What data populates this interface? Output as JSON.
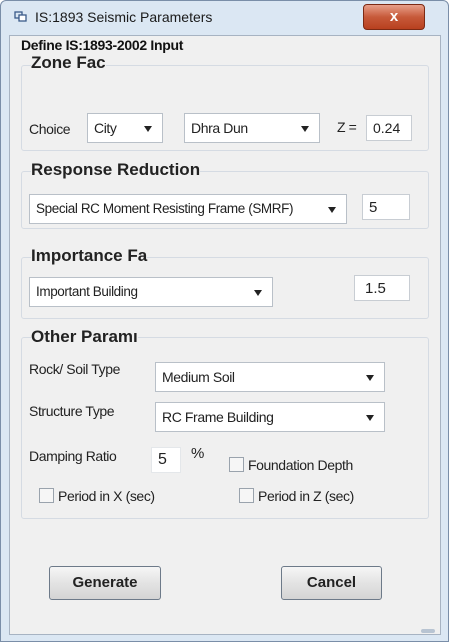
{
  "window": {
    "title": "IS:1893 Seismic Parameters",
    "close_label": "x"
  },
  "define_label": "Define IS:1893-2002 Input",
  "zone": {
    "title": "Zone Fac",
    "choice_label": "Choice",
    "choice_value": "City",
    "city_value": "Dhra Dun",
    "z_label": "Z =",
    "z_value": "0.24"
  },
  "response": {
    "title": "Response Reduction",
    "frame_value": "Special RC Moment Resisting Frame (SMRF)",
    "r_value": "5"
  },
  "importance": {
    "title": "Importance Fa",
    "value": "Important Building",
    "factor": "1.5"
  },
  "other": {
    "title": "Other Paramı",
    "soil_label": "Rock/ Soil Type",
    "soil_value": "Medium Soil",
    "structure_label": "Structure Type",
    "structure_value": "RC Frame Building",
    "damping_label": "Damping Ratio",
    "damping_value": "5",
    "damping_unit": "%",
    "foundation_label": "Foundation Depth",
    "period_x_label": "Period in X (sec)",
    "period_z_label": "Period in Z (sec)"
  },
  "buttons": {
    "generate": "Generate",
    "cancel": "Cancel"
  }
}
